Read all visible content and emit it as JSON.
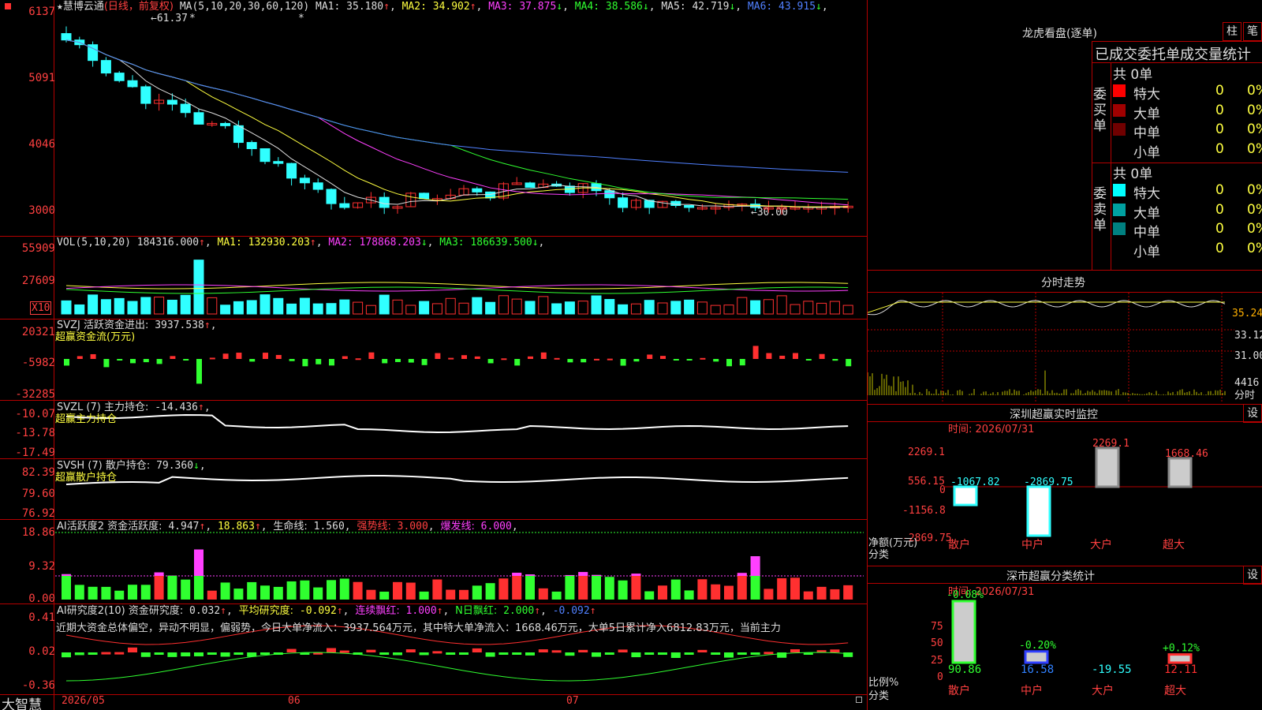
{
  "app": {
    "logo": "大智慧",
    "stock": "慧博云通",
    "mode": "(日线，前复权)",
    "star": "★"
  },
  "main": {
    "ma_label": "MA(5,10,20,30,60,120)",
    "ma": [
      {
        "name": "MA1:",
        "val": "35.180",
        "arrow": "↑",
        "color": "#dddddd"
      },
      {
        "name": "MA2:",
        "val": "34.902",
        "arrow": "↑",
        "color": "#ffff40"
      },
      {
        "name": "MA3:",
        "val": "37.875",
        "arrow": "↓",
        "color": "#ff40ff"
      },
      {
        "name": "MA4:",
        "val": "38.586",
        "arrow": "↓",
        "color": "#30ff30"
      },
      {
        "name": "MA5:",
        "val": "42.719",
        "arrow": "↓",
        "color": "#dddddd"
      },
      {
        "name": "MA6:",
        "val": "43.915",
        "arrow": "↓",
        "color": "#5080ff"
      }
    ],
    "y_labels": [
      "6137",
      "5091",
      "4046",
      "3000"
    ],
    "high": "61.37",
    "low": "←30.00"
  },
  "vol": {
    "label": "VOL(5,10,20)",
    "value": "184316.000",
    "ma": [
      {
        "name": "MA1:",
        "val": "132930.203",
        "arrow": "↑",
        "color": "#ffff40"
      },
      {
        "name": "MA2:",
        "val": "178868.203",
        "arrow": "↓",
        "color": "#ff40ff"
      },
      {
        "name": "MA3:",
        "val": "186639.500",
        "arrow": "↓",
        "color": "#30ff30"
      }
    ],
    "y_labels": [
      "55909",
      "27609"
    ],
    "unit": "X10"
  },
  "svzj": {
    "label": "SVZJ  活跃资金进出:",
    "value": "3937.538",
    "sub": "超赢资金流(万元)",
    "y_labels": [
      "20321",
      "-5982",
      "-32285"
    ]
  },
  "svzl": {
    "label": "SVZL (7) 主力持仓:",
    "value": "-14.436",
    "sub": "超赢主力持仓",
    "y_labels": [
      "-10.07",
      "-13.78",
      "-17.49"
    ]
  },
  "svsh": {
    "label": "SVSH (7) 散户持仓:",
    "value": "79.360",
    "sub": "超赢散户持仓",
    "y_labels": [
      "82.39",
      "79.60",
      "76.92"
    ]
  },
  "ai1": {
    "label": "AI活跃度2 资金活跃度:",
    "value": "4.947",
    "v2": "18.863",
    "life": "生命线:",
    "v3": "1.560",
    "strong": "强势线:",
    "v4": "3.000",
    "burst": "爆发线:",
    "v5": "6.000",
    "y_labels": [
      "18.86",
      "9.32",
      "0.00"
    ]
  },
  "ai2": {
    "label": "AI研究度2(10) 资金研究度:",
    "value": "0.032",
    "avg": "平均研究度:",
    "v2": "-0.092",
    "lianxu": "连续飘红:",
    "v3": "1.000",
    "nri": "N日飘红:",
    "v4": "2.000",
    "v5": "-0.092",
    "desc": "近期大资金总体偏空，异动不明显，偏弱势，今日大单净流入：3937.564万元，其中特大单净流入：1668.46万元，大单5日累计净入6812.83万元，当前主力",
    "y_labels": [
      "0.41",
      "0.02",
      "-0.36"
    ]
  },
  "xaxis": [
    "2026/05",
    "06",
    "07"
  ],
  "right": {
    "title": "龙虎看盘(逐单)",
    "btn1": "柱",
    "btn2": "笔",
    "stats_header": "已成交委托单成交量统计",
    "buy": {
      "side": "委买单",
      "total": "共 0单",
      "rows": [
        {
          "name": "特大",
          "v": "0",
          "p": "0%",
          "color": "#ff0000"
        },
        {
          "name": "大单",
          "v": "0",
          "p": "0%",
          "color": "#a00000"
        },
        {
          "name": "中单",
          "v": "0",
          "p": "0%",
          "color": "#700000"
        },
        {
          "name": "小单",
          "v": "0",
          "p": "0%",
          "color": "#000000"
        }
      ]
    },
    "sell": {
      "side": "委卖单",
      "total": "共 0单",
      "rows": [
        {
          "name": "特大",
          "v": "0",
          "p": "0%",
          "color": "#00ffff"
        },
        {
          "name": "大单",
          "v": "0",
          "p": "0%",
          "color": "#00a0a0"
        },
        {
          "name": "中单",
          "v": "0",
          "p": "0%",
          "color": "#008080"
        },
        {
          "name": "小单",
          "v": "0",
          "p": "0%",
          "color": "#000000"
        }
      ]
    },
    "intraday": {
      "title": "分时走势",
      "labels": [
        "35.24",
        "33.12",
        "31.00",
        "4416",
        "分时"
      ]
    },
    "monitor": {
      "title": "深圳超赢实时监控",
      "set": "设",
      "time": "时间: 2026/07/31",
      "y_labels": [
        "2269.1",
        "556.15",
        "0",
        "-1156.8",
        "-2869.75"
      ],
      "ylabel1": "净额(万元)",
      "ylabel2": "分类",
      "bars": [
        {
          "name": "散户",
          "val": "-1067.82"
        },
        {
          "name": "中户",
          "val": "-2869.75"
        },
        {
          "name": "大户",
          "val": "2269.1"
        },
        {
          "name": "超大",
          "val": "1668.46"
        }
      ]
    },
    "classify": {
      "title": "深市超赢分类统计",
      "set": "设",
      "time": "时间: 2026/07/31",
      "y_labels": [
        "75",
        "50",
        "25",
        "0"
      ],
      "ylabel1": "比例%",
      "ylabel2": "分类",
      "bars": [
        {
          "name": "散户",
          "pct": "-0.08%",
          "val": "90.86"
        },
        {
          "name": "中户",
          "pct": "-0.20%",
          "val": "16.58"
        },
        {
          "name": "大户",
          "pct": "",
          "val": "-19.55"
        },
        {
          "name": "超大",
          "pct": "+0.12%",
          "val": "12.11"
        }
      ]
    }
  }
}
